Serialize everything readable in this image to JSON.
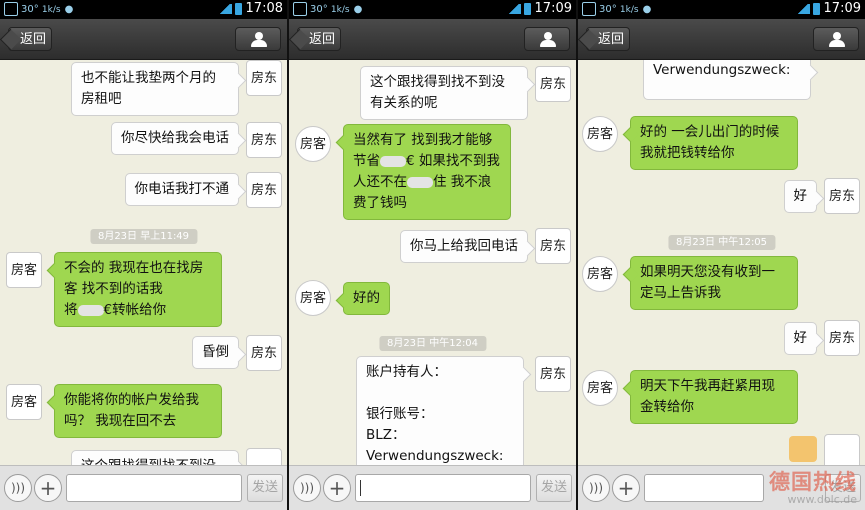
{
  "panels": [
    {
      "status": {
        "time": "17:08",
        "temp": "30°",
        "speed": "1k/s"
      },
      "nav": {
        "back": "返回"
      },
      "input": {
        "send": "发送"
      },
      "messages": [
        {
          "side": "right",
          "text": "也不能让我垫两个月的\n房租吧",
          "avatar": "房东"
        },
        {
          "side": "right",
          "text": "你尽快给我会电话",
          "avatar": "房东"
        },
        {
          "side": "right",
          "text": "你电话我打不通",
          "avatar": "房东"
        },
        {
          "kind": "time",
          "text": "8月23日 早上11:49"
        },
        {
          "side": "left",
          "parts": [
            "不会的 我现在也在找房\n客 找不到的话我\n将",
            "€转帐给你"
          ],
          "avatar": "房客"
        },
        {
          "side": "right",
          "text": "昏倒",
          "avatar": "房东"
        },
        {
          "side": "left",
          "text": "你能将你的帐户发给我\n吗？ 我现在回不去",
          "avatar": "房客"
        },
        {
          "side": "right",
          "text": "这个跟找得到找不到没",
          "avatar": ""
        }
      ]
    },
    {
      "status": {
        "time": "17:09",
        "temp": "30°",
        "speed": "1k/s"
      },
      "nav": {
        "back": "返回"
      },
      "input": {
        "send": "发送"
      },
      "messages": [
        {
          "side": "right",
          "text": "这个跟找得到找不到没\n有关系的呢",
          "avatar": "房东"
        },
        {
          "side": "left",
          "parts": [
            "当然有了 找到我才能够\n节省",
            "€ 如果找不到我\n人还不在",
            "住 我不浪\n费了钱吗"
          ],
          "avatar": "房客"
        },
        {
          "side": "right",
          "text": "你马上给我回电话",
          "avatar": "房东"
        },
        {
          "side": "left",
          "text": "好的",
          "avatar": "房客"
        },
        {
          "kind": "time",
          "text": "8月23日 中午12:04"
        },
        {
          "side": "right",
          "text": "账户持有人：\n\n银行账号：\nBLZ：\nVerwendungszweck:",
          "avatar": "房东"
        }
      ]
    },
    {
      "status": {
        "time": "17:09",
        "temp": "30°",
        "speed": "1k/s"
      },
      "nav": {
        "back": "返回"
      },
      "input": {
        "send": "发送"
      },
      "messages": [
        {
          "side": "right",
          "text": "Verwendungszweck:",
          "avatar": ""
        },
        {
          "side": "left",
          "text": "好的 一会儿出门的时候\n我就把钱转给你",
          "avatar": "房客"
        },
        {
          "side": "right",
          "text": "好",
          "avatar": "房东"
        },
        {
          "kind": "time",
          "text": "8月23日 中午12:05"
        },
        {
          "side": "left",
          "text": "如果明天您没有收到一\n定马上告诉我",
          "avatar": "房客"
        },
        {
          "side": "right",
          "text": "好",
          "avatar": "房东"
        },
        {
          "side": "left",
          "text": "明天下午我再赶紧用现\n金转给你",
          "avatar": "房客"
        }
      ],
      "watermark": {
        "title": "德国热线",
        "url": "www.dolc.de"
      }
    }
  ]
}
